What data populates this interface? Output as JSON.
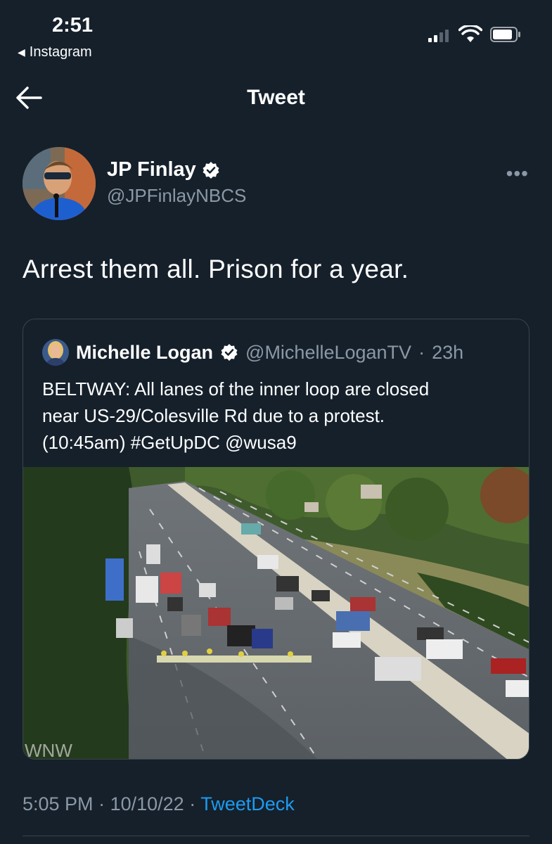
{
  "status_bar": {
    "time": "2:51",
    "back_app": "Instagram"
  },
  "nav": {
    "title": "Tweet"
  },
  "tweet": {
    "author_name": "JP Finlay",
    "author_handle": "@JPFinlayNBCS",
    "text": "Arrest them all. Prison for a year.",
    "time": "5:05 PM",
    "date": "10/10/22",
    "source": "TweetDeck",
    "separator": "·"
  },
  "quoted_tweet": {
    "author_name": "Michelle Logan",
    "author_handle": "@MichelleLoganTV",
    "age": "23h",
    "separator": "·",
    "text_lines": [
      "BELTWAY: All lanes of the inner loop are closed",
      "near US-29/Colesville Rd due to a protest.",
      "(10:45am) #GetUpDC @wusa9"
    ],
    "media_watermark": "WNW"
  },
  "icons": {
    "back": "arrow-left-icon",
    "verified": "verified-badge-icon",
    "more": "more-horizontal-icon",
    "signal": "cellular-signal-icon",
    "wifi": "wifi-icon",
    "battery": "battery-icon"
  },
  "colors": {
    "background": "#15202b",
    "secondary_text": "#8b98a5",
    "link": "#1d9bf0",
    "border": "#38444d"
  }
}
